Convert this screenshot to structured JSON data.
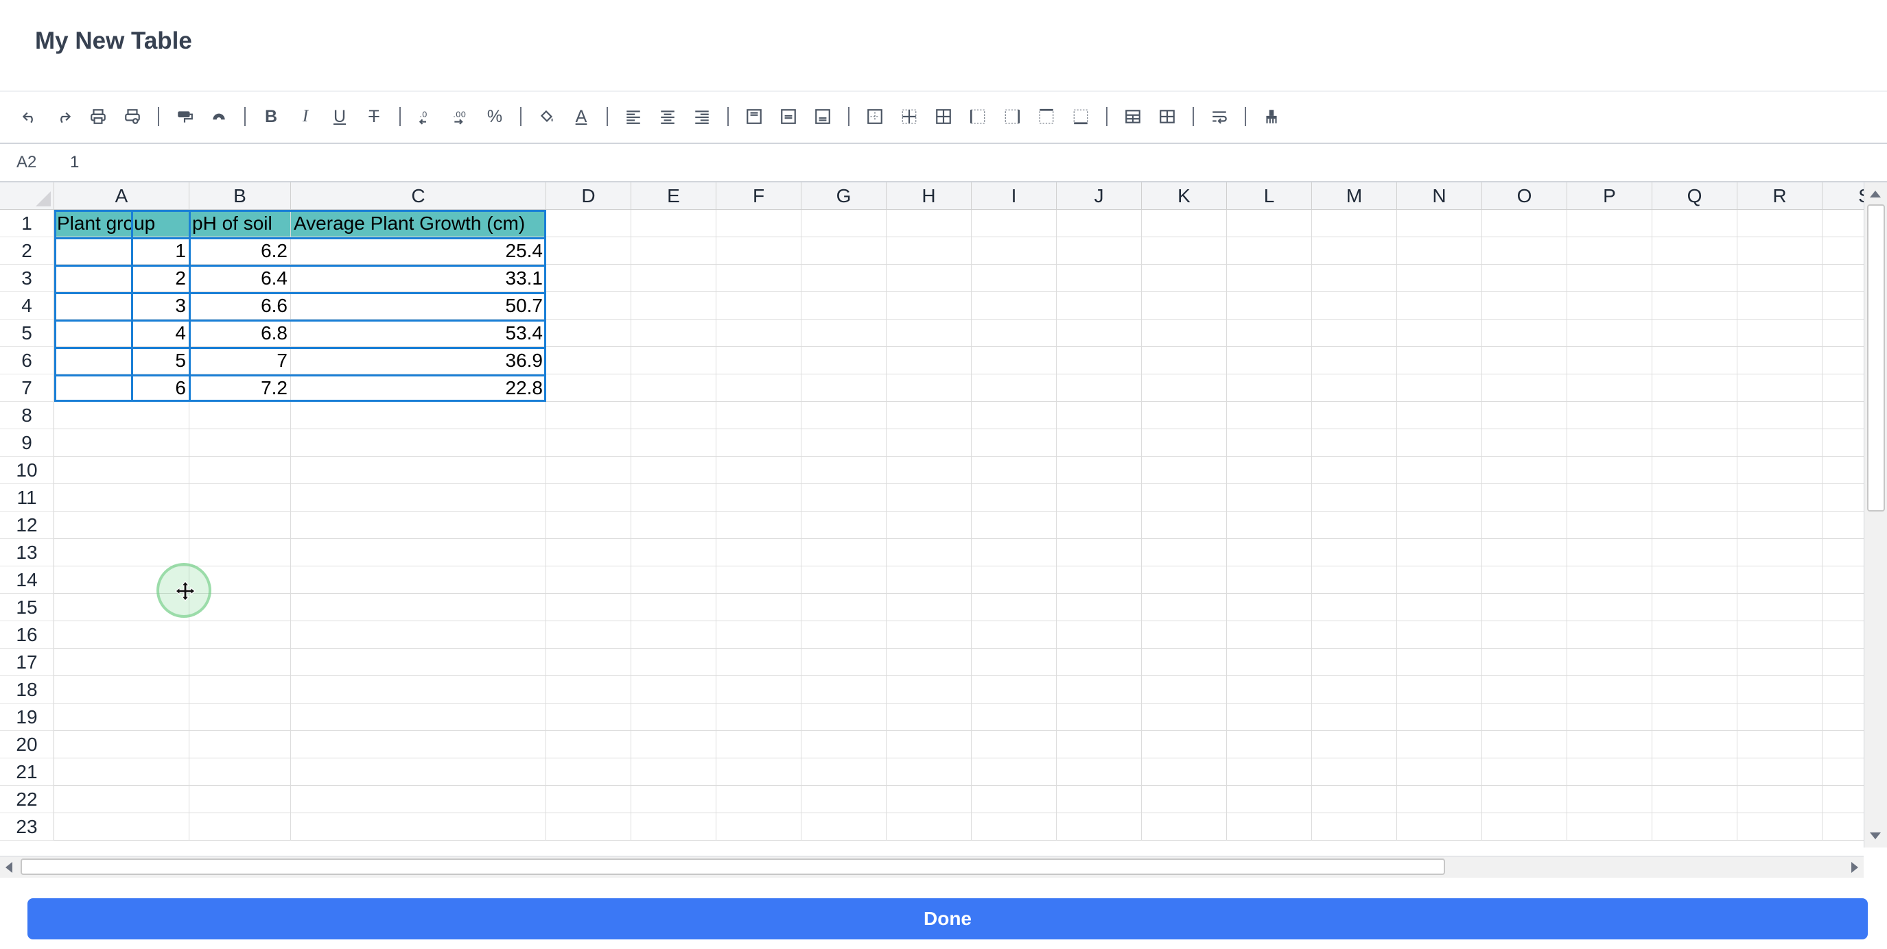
{
  "dialog": {
    "title": "My New Table"
  },
  "toolbar": {
    "groups": [
      [
        "undo-icon",
        "redo-icon",
        "print-icon",
        "print-preview-icon"
      ],
      [
        "paint-format-icon",
        "clear-format-icon"
      ],
      [
        "bold-icon",
        "italic-icon",
        "underline-icon",
        "strikethrough-icon"
      ],
      [
        "decrease-decimal-icon",
        "increase-decimal-icon",
        "percent-icon"
      ],
      [
        "fill-color-icon",
        "text-color-icon"
      ],
      [
        "align-left-icon",
        "align-center-icon",
        "align-right-icon"
      ],
      [
        "valign-top-icon",
        "valign-middle-icon",
        "valign-bottom-icon"
      ],
      [
        "border-outer-icon",
        "border-inner-icon",
        "border-all-icon",
        "border-left-icon",
        "border-right-icon",
        "border-top-icon",
        "border-bottom-icon"
      ],
      [
        "insert-row-icon",
        "insert-column-icon"
      ],
      [
        "wrap-text-icon"
      ],
      [
        "clear-icon"
      ]
    ],
    "glyphs": {
      "bold-icon": "B",
      "italic-icon": "I",
      "underline-icon": "U",
      "strikethrough-icon": "T",
      "percent-icon": "%",
      "text-color-icon": "A"
    }
  },
  "formula_bar": {
    "cell_ref": "A2",
    "value": "1"
  },
  "sheet": {
    "columns": [
      "A",
      "B",
      "C",
      "D",
      "E",
      "F",
      "G",
      "H",
      "I",
      "J",
      "K",
      "L",
      "M",
      "N",
      "O",
      "P",
      "Q",
      "R",
      "S"
    ],
    "row_numbers": [
      "1",
      "2",
      "3",
      "4",
      "5",
      "6",
      "7",
      "8",
      "9",
      "10",
      "11",
      "12",
      "13",
      "14",
      "15",
      "16",
      "17",
      "18",
      "19",
      "20",
      "21",
      "22",
      "23"
    ],
    "header_row": [
      "Plant group",
      "pH of soil",
      "Average Plant Growth (cm)"
    ],
    "data_rows": [
      [
        "1",
        "6.2",
        "25.4"
      ],
      [
        "2",
        "6.4",
        "33.1"
      ],
      [
        "3",
        "6.6",
        "50.7"
      ],
      [
        "4",
        "6.8",
        "53.4"
      ],
      [
        "5",
        "7",
        "36.9"
      ],
      [
        "6",
        "7.2",
        "22.8"
      ]
    ],
    "header_fill_color": "#5fc1bf",
    "selection_color": "#1a7fd6"
  },
  "footer": {
    "done_label": "Done",
    "done_color": "#3b78f5"
  }
}
